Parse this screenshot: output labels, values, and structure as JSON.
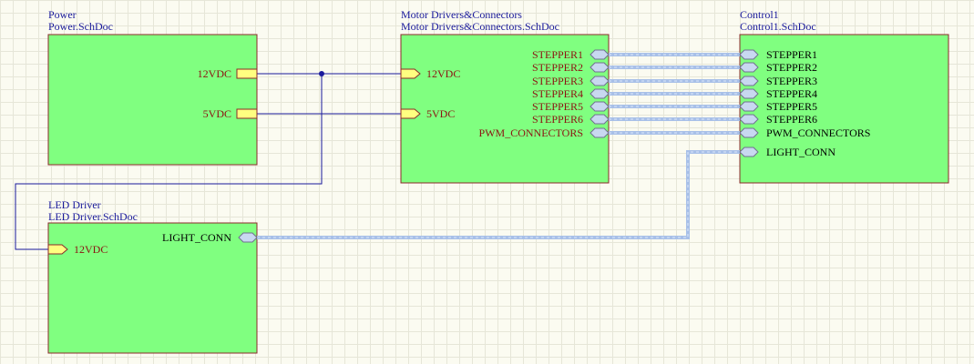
{
  "colors": {
    "sheet_fill": "#80ff80",
    "sheet_border": "#8c2a2a",
    "wire": "#1a1a9c",
    "bus": "#a8c0e8",
    "port_power": "#ffff80",
    "port_bus": "#c8d8f0",
    "title_text": "#1a1a9c",
    "port_text": "#8c1212"
  },
  "sheets": {
    "power": {
      "name": "Power",
      "file": "Power.SchDoc",
      "ports": {
        "p12": "12VDC",
        "p5": "5VDC"
      }
    },
    "motor": {
      "name": "Motor Drivers&Connectors",
      "file": "Motor Drivers&Connectors.SchDoc",
      "ports": {
        "p12": "12VDC",
        "p5": "5VDC",
        "s1": "STEPPER1",
        "s2": "STEPPER2",
        "s3": "STEPPER3",
        "s4": "STEPPER4",
        "s5": "STEPPER5",
        "s6": "STEPPER6",
        "pwm": "PWM_CONNECTORS"
      }
    },
    "control": {
      "name": "Control1",
      "file": "Control1.SchDoc",
      "ports": {
        "s1": "STEPPER1",
        "s2": "STEPPER2",
        "s3": "STEPPER3",
        "s4": "STEPPER4",
        "s5": "STEPPER5",
        "s6": "STEPPER6",
        "pwm": "PWM_CONNECTORS",
        "light": "LIGHT_CONN"
      }
    },
    "led": {
      "name": "LED Driver",
      "file": "LED Driver.SchDoc",
      "ports": {
        "p12": "12VDC",
        "light": "LIGHT_CONN"
      }
    }
  }
}
